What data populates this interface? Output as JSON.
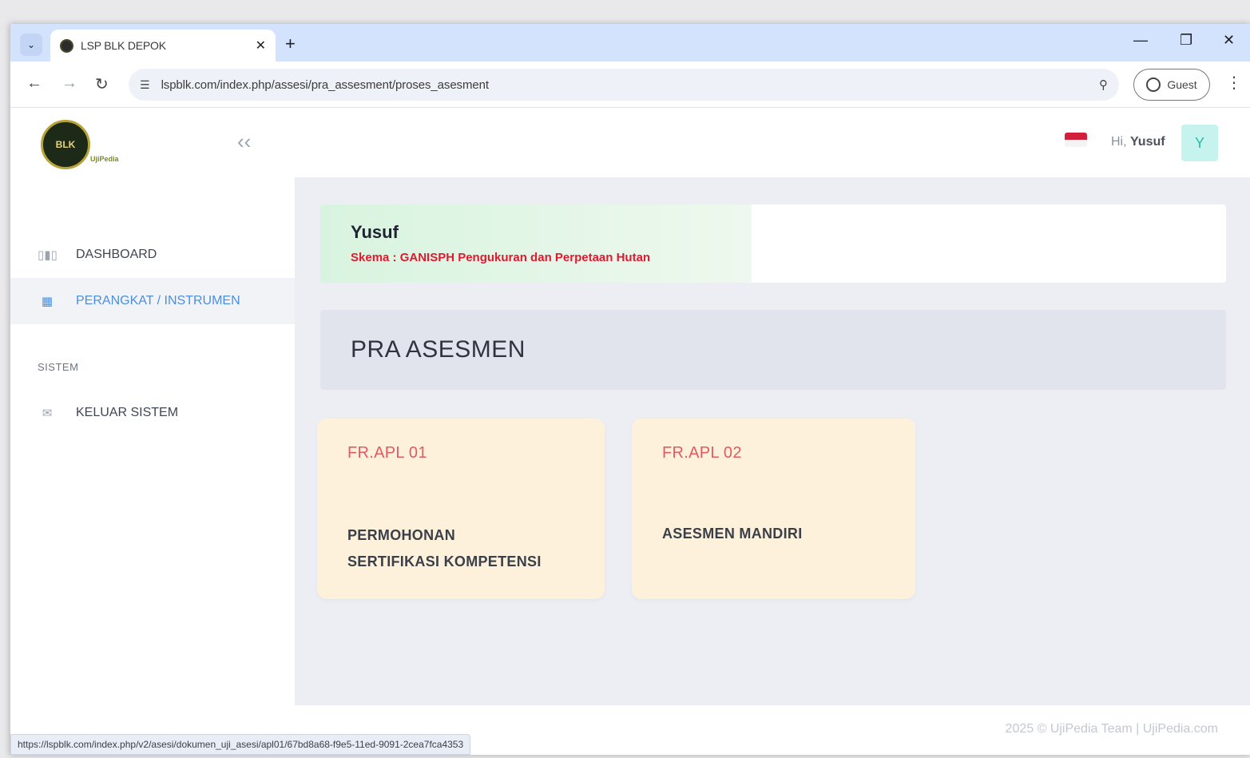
{
  "browser": {
    "tab_title": "LSP BLK DEPOK",
    "url": "lspblk.com/index.php/assesi/pra_assesment/proses_asesment",
    "guest_label": "Guest",
    "status_url": "https://lspblk.com/index.php/v2/asesi/dokumen_uji_asesi/apl01/67bd8a68-f9e5-11ed-9091-2cea7fca4353"
  },
  "sidebar": {
    "logo_text": "BLK",
    "logo_caption": "UjiPedia",
    "items": [
      {
        "label": "DASHBOARD",
        "icon": "bar-chart-icon"
      },
      {
        "label": "PERANGKAT / INSTRUMEN",
        "icon": "grid-icon"
      }
    ],
    "section_label": "SISTEM",
    "system_items": [
      {
        "label": "KELUAR SISTEM",
        "icon": "mail-icon"
      }
    ]
  },
  "topbar": {
    "greeting": "Hi,",
    "user_name": "Yusuf",
    "avatar_initial": "Y"
  },
  "profile": {
    "name": "Yusuf",
    "scheme": "Skema : GANISPH Pengukuran dan Perpetaan Hutan"
  },
  "section": {
    "title": "PRA ASESMEN"
  },
  "cards": [
    {
      "code": "FR.APL 01",
      "title_line1": "PERMOHONAN",
      "title_line2": "SERTIFIKASI KOMPETENSI"
    },
    {
      "code": "FR.APL 02",
      "title_line1": "ASESMEN MANDIRI",
      "title_line2": ""
    }
  ],
  "footer": {
    "text": "2025 © UjiPedia Team | UjiPedia.com"
  },
  "colors": {
    "accent_blue": "#4a8fe0",
    "scheme_red": "#e0192e",
    "card_bg": "#fdf1dc",
    "card_code": "#e45a63"
  }
}
